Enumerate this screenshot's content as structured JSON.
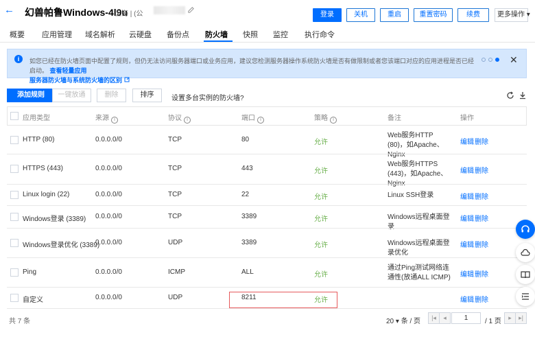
{
  "header": {
    "title": "幻兽帕鲁Windows-4l9u",
    "region": "上海 | (公",
    "buttons": [
      "登录",
      "关机",
      "重启",
      "重置密码",
      "续费"
    ],
    "more": "更多操作 ▾"
  },
  "tabs": [
    "概要",
    "应用管理",
    "域名解析",
    "云硬盘",
    "备份点",
    "防火墙",
    "快照",
    "监控",
    "执行命令"
  ],
  "active_tab": "防火墙",
  "notice": {
    "text": "如您已经在防火墙页面中配置了规则，但仍无法访问服务器端口或业务应用，建议您检测服务器操作系统防火墙是否有做限制或者您该端口对应的应用进程是否已经启动。",
    "link1": "查看轻量应用",
    "link2": "服务器防火墙与系统防火墙的区别"
  },
  "toolbar": {
    "add": "添加规则",
    "one_click": "一键放通",
    "delete": "删除",
    "sort": "排序",
    "multi": "设置多台实例的防火墙?"
  },
  "columns": [
    "应用类型",
    "来源",
    "协议",
    "端口",
    "策略",
    "备注",
    "操作"
  ],
  "rows": [
    {
      "app": "HTTP (80)",
      "source": "0.0.0.0/0",
      "proto": "TCP",
      "port": "80",
      "policy": "允许",
      "note": "Web服务HTTP (80)，如Apache、Nginx"
    },
    {
      "app": "HTTPS (443)",
      "source": "0.0.0.0/0",
      "proto": "TCP",
      "port": "443",
      "policy": "允许",
      "note": "Web服务HTTPS (443)，如Apache、Nginx"
    },
    {
      "app": "Linux login (22)",
      "source": "0.0.0.0/0",
      "proto": "TCP",
      "port": "22",
      "policy": "允许",
      "note": "Linux SSH登录"
    },
    {
      "app": "Windows登录 (3389)",
      "source": "0.0.0.0/0",
      "proto": "TCP",
      "port": "3389",
      "policy": "允许",
      "note": "Windows远程桌面登录"
    },
    {
      "app": "Windows登录优化 (3389)",
      "source": "0.0.0.0/0",
      "proto": "UDP",
      "port": "3389",
      "policy": "允许",
      "note": "Windows远程桌面登录优化"
    },
    {
      "app": "Ping",
      "source": "0.0.0.0/0",
      "proto": "ICMP",
      "port": "ALL",
      "policy": "允许",
      "note": "通过Ping测试网络连通性(放通ALL ICMP)"
    },
    {
      "app": "自定义",
      "source": "0.0.0.0/0",
      "proto": "UDP",
      "port": "8211",
      "policy": "允许",
      "note": ""
    }
  ],
  "ops": {
    "edit": "编辑",
    "delete": "删除"
  },
  "footer": {
    "total": "共 7 条",
    "page_size": "20 ▾ 条 / 页",
    "page": "1",
    "page_total": "/ 1 页"
  }
}
